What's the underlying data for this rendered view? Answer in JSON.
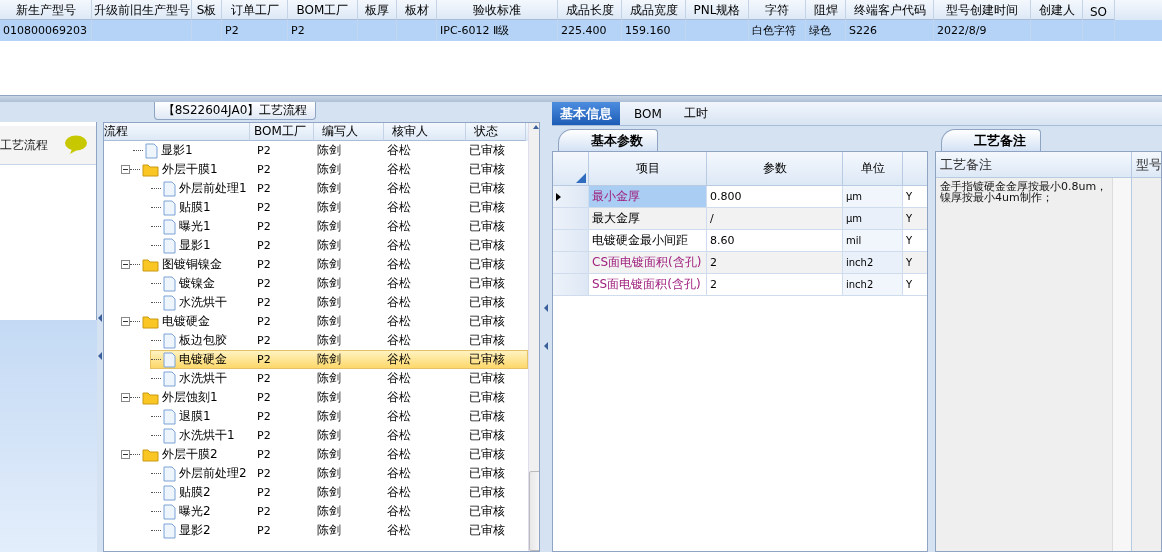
{
  "top_grid": {
    "columns": [
      "新生产型号",
      "升级前旧生产型号",
      "S板",
      "订单工厂",
      "BOM工厂",
      "板厚",
      "板材",
      "验收标准",
      "成品长度",
      "成品宽度",
      "PNL规格",
      "字符",
      "阻焊",
      "终端客户代码",
      "型号创建时间",
      "创建人",
      "SO"
    ],
    "rows": [
      {
        "selected": true,
        "cells": [
          "010800069203",
          "",
          "",
          "P2",
          "P2",
          "",
          "",
          "IPC-6012 Ⅱ级",
          "225.400",
          "159.160",
          "",
          "白色字符",
          "绿色",
          "S226",
          "2022/8/9",
          "",
          ""
        ]
      }
    ]
  },
  "flow_panel": {
    "title": "【8S22604JA0】工艺流程",
    "side_label": "工艺流程",
    "columns": [
      "流程",
      "BOM工厂",
      "编写人",
      "核审人",
      "状态"
    ],
    "tree": [
      {
        "name": "显影1",
        "kind": "file",
        "factory": "P2",
        "writer": "陈剑",
        "reviewer": "谷松",
        "status": "已审核",
        "selected": false
      },
      {
        "name": "外层干膜1",
        "kind": "folder",
        "expanded": true,
        "factory": "P2",
        "writer": "陈剑",
        "reviewer": "谷松",
        "status": "已审核",
        "selected": false,
        "children": [
          {
            "name": "外层前处理1",
            "kind": "file",
            "factory": "P2",
            "writer": "陈剑",
            "reviewer": "谷松",
            "status": "已审核",
            "selected": false
          },
          {
            "name": "贴膜1",
            "kind": "file",
            "factory": "P2",
            "writer": "陈剑",
            "reviewer": "谷松",
            "status": "已审核",
            "selected": false
          },
          {
            "name": "曝光1",
            "kind": "file",
            "factory": "P2",
            "writer": "陈剑",
            "reviewer": "谷松",
            "status": "已审核",
            "selected": false
          },
          {
            "name": "显影1",
            "kind": "file",
            "factory": "P2",
            "writer": "陈剑",
            "reviewer": "谷松",
            "status": "已审核",
            "selected": false
          }
        ]
      },
      {
        "name": "图镀铜镍金",
        "kind": "folder",
        "expanded": true,
        "factory": "P2",
        "writer": "陈剑",
        "reviewer": "谷松",
        "status": "已审核",
        "selected": false,
        "children": [
          {
            "name": "镀镍金",
            "kind": "file",
            "factory": "P2",
            "writer": "陈剑",
            "reviewer": "谷松",
            "status": "已审核",
            "selected": false
          },
          {
            "name": "水洗烘干",
            "kind": "file",
            "factory": "P2",
            "writer": "陈剑",
            "reviewer": "谷松",
            "status": "已审核",
            "selected": false
          }
        ]
      },
      {
        "name": "电镀硬金",
        "kind": "folder",
        "expanded": true,
        "factory": "P2",
        "writer": "陈剑",
        "reviewer": "谷松",
        "status": "已审核",
        "selected": false,
        "children": [
          {
            "name": "板边包胶",
            "kind": "file",
            "factory": "P2",
            "writer": "陈剑",
            "reviewer": "谷松",
            "status": "已审核",
            "selected": false
          },
          {
            "name": "电镀硬金",
            "kind": "file",
            "factory": "P2",
            "writer": "陈剑",
            "reviewer": "谷松",
            "status": "已审核",
            "selected": true
          },
          {
            "name": "水洗烘干",
            "kind": "file",
            "factory": "P2",
            "writer": "陈剑",
            "reviewer": "谷松",
            "status": "已审核",
            "selected": false
          }
        ]
      },
      {
        "name": "外层蚀刻1",
        "kind": "folder",
        "expanded": true,
        "factory": "P2",
        "writer": "陈剑",
        "reviewer": "谷松",
        "status": "已审核",
        "selected": false,
        "children": [
          {
            "name": "退膜1",
            "kind": "file",
            "factory": "P2",
            "writer": "陈剑",
            "reviewer": "谷松",
            "status": "已审核",
            "selected": false
          },
          {
            "name": "水洗烘干1",
            "kind": "file",
            "factory": "P2",
            "writer": "陈剑",
            "reviewer": "谷松",
            "status": "已审核",
            "selected": false
          }
        ]
      },
      {
        "name": "外层干膜2",
        "kind": "folder",
        "expanded": true,
        "factory": "P2",
        "writer": "陈剑",
        "reviewer": "谷松",
        "status": "已审核",
        "selected": false,
        "children": [
          {
            "name": "外层前处理2",
            "kind": "file",
            "factory": "P2",
            "writer": "陈剑",
            "reviewer": "谷松",
            "status": "已审核",
            "selected": false
          },
          {
            "name": "贴膜2",
            "kind": "file",
            "factory": "P2",
            "writer": "陈剑",
            "reviewer": "谷松",
            "status": "已审核",
            "selected": false
          },
          {
            "name": "曝光2",
            "kind": "file",
            "factory": "P2",
            "writer": "陈剑",
            "reviewer": "谷松",
            "status": "已审核",
            "selected": false
          },
          {
            "name": "显影2",
            "kind": "file",
            "factory": "P2",
            "writer": "陈剑",
            "reviewer": "谷松",
            "status": "已审核",
            "selected": false
          }
        ]
      }
    ]
  },
  "detail_tabs": [
    {
      "label": "基本信息",
      "selected": true
    },
    {
      "label": "BOM",
      "selected": false
    },
    {
      "label": "工时",
      "selected": false
    }
  ],
  "params": {
    "tab": "基本参数",
    "columns": [
      "项目",
      "参数",
      "单位"
    ],
    "rows": [
      {
        "item": "最小金厚",
        "value": "0.800",
        "unit": "μm",
        "column_4": "Y",
        "highlighted": true,
        "selected": true
      },
      {
        "item": "最大金厚",
        "value": "/",
        "unit": "μm",
        "column_4": "Y",
        "highlighted": false,
        "selected": false
      },
      {
        "item": "电镀硬金最小间距",
        "value": "8.60",
        "unit": "mil",
        "column_4": "Y",
        "highlighted": false,
        "selected": false
      },
      {
        "item": "CS面电镀面积(含孔)",
        "value": "2",
        "unit": "inch2",
        "column_4": "Y",
        "highlighted": true,
        "selected": false
      },
      {
        "item": "SS面电镀面积(含孔)",
        "value": "2",
        "unit": "inch2",
        "column_4": "Y",
        "highlighted": true,
        "selected": false
      }
    ]
  },
  "notes": {
    "tab": "工艺备注",
    "columns": [
      "工艺备注",
      "型号"
    ],
    "text_lines": [
      "金手指镀硬金金厚按最小0.8um，",
      "镍厚按最小4um制作；"
    ]
  }
}
